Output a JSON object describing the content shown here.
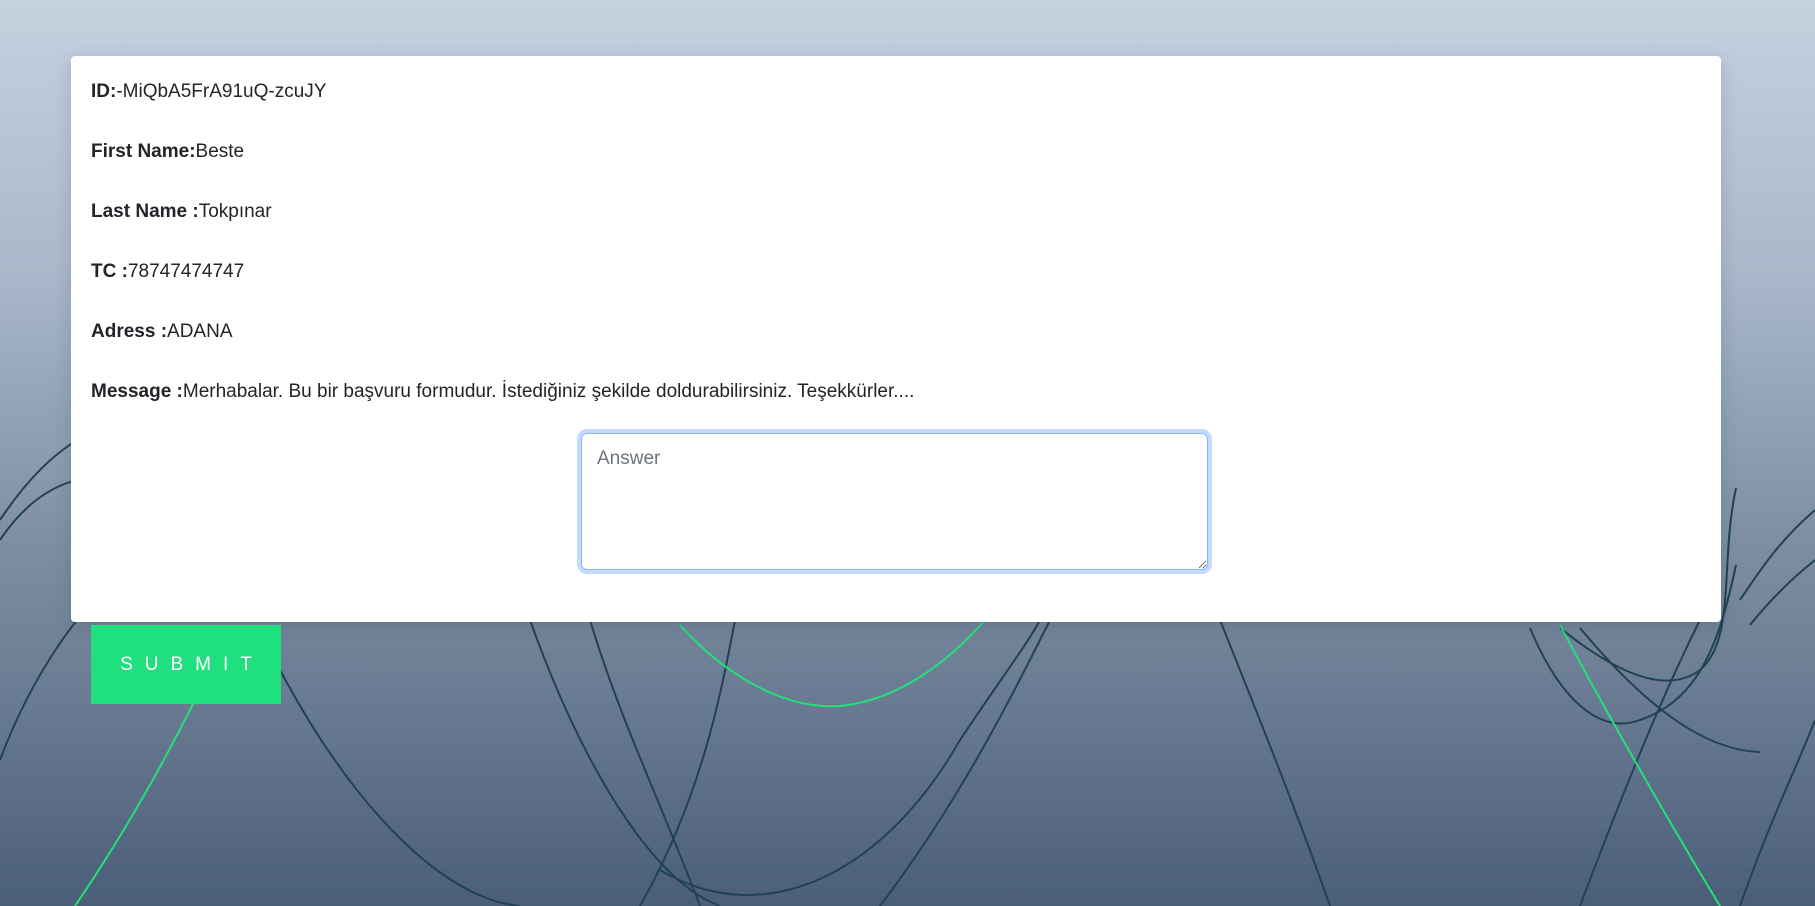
{
  "record": {
    "id_label": "ID:",
    "id_value": "-MiQbA5FrA91uQ-zcuJY",
    "first_name_label": "First Name:",
    "first_name_value": "Beste",
    "last_name_label": "Last Name :",
    "last_name_value": "Tokpınar",
    "tc_label": "TC :",
    "tc_value": "78747474747",
    "address_label": "Adress :",
    "address_value": "ADANA",
    "message_label": "Message :",
    "message_value": "Merhabalar. Bu bir başvuru formudur. İstediğiniz şekilde doldurabilirsiniz. Teşekkürler...."
  },
  "answer": {
    "placeholder": "Answer",
    "value": ""
  },
  "submit": {
    "label": "SUBMIT"
  },
  "colors": {
    "accent": "#20df7f",
    "line_dark": "#1f4352",
    "line_accent": "#22e07a"
  }
}
